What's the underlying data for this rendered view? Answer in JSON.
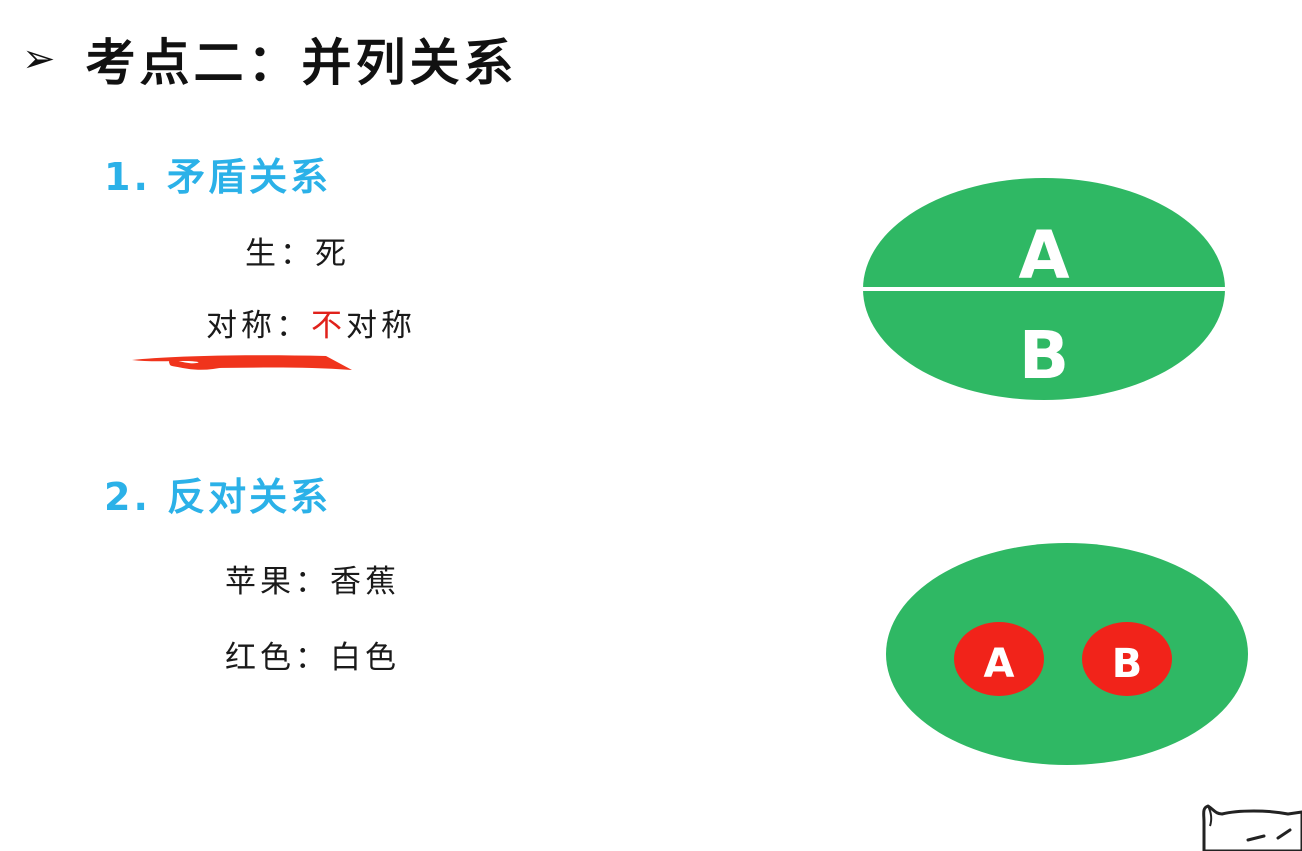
{
  "title": {
    "bullet": "➢",
    "text": "考点二：并列关系"
  },
  "sections": [
    {
      "heading": "1. 矛盾关系",
      "pairs": [
        {
          "text": "生：死"
        },
        {
          "prefix": "对称：",
          "neg": "不",
          "suffix": "对称"
        }
      ],
      "diagram": {
        "upper_label": "A",
        "lower_label": "B"
      }
    },
    {
      "heading": "2. 反对关系",
      "pairs": [
        {
          "text": "苹果：香蕉"
        },
        {
          "text": "红色：白色"
        }
      ],
      "diagram": {
        "left_label": "A",
        "right_label": "B"
      }
    }
  ],
  "colors": {
    "heading": "#2bb1e8",
    "ellipse_green": "#2fb864",
    "circle_red": "#f1231a",
    "negation_red": "#e0211b"
  }
}
